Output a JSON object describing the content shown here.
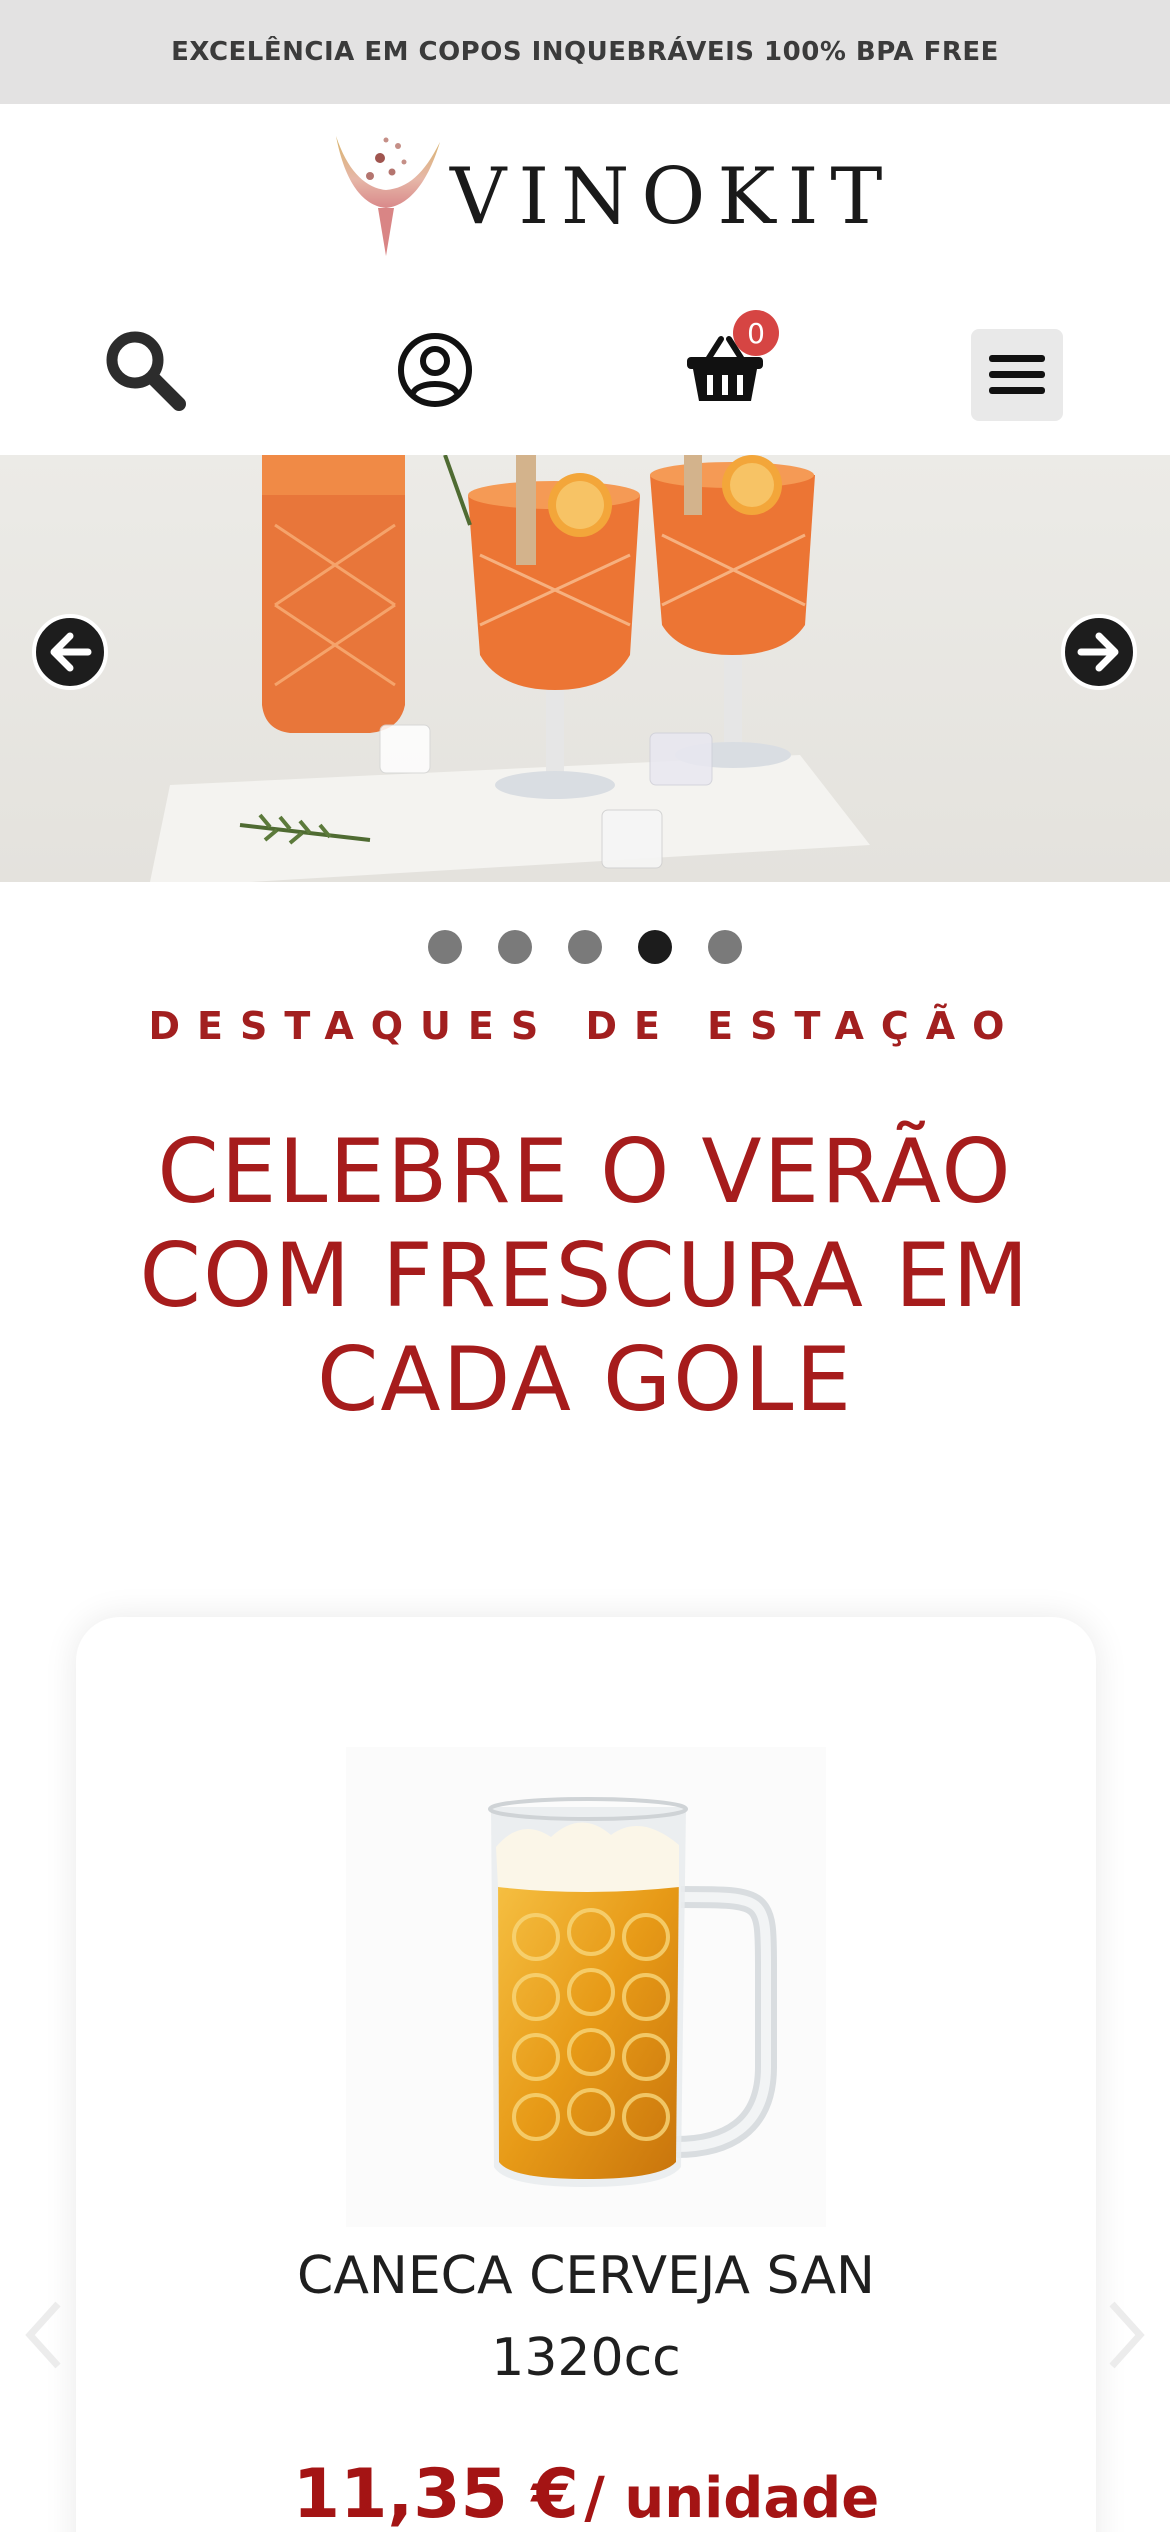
{
  "announcement": {
    "text": "EXCELÊNCIA EM COPOS INQUEBRÁVEIS 100% BPA FREE"
  },
  "brand": {
    "name": "VINOKIT",
    "accent": "#a21f1f"
  },
  "header": {
    "search_icon": "search-icon",
    "account_icon": "user-circle-icon",
    "cart_icon": "basket-icon",
    "cart_count": "0",
    "menu_icon": "hamburger-icon"
  },
  "hero": {
    "slides_total": 5,
    "active_slide": 4,
    "prev_icon": "arrow-left-icon",
    "next_icon": "arrow-right-icon"
  },
  "section": {
    "eyebrow": "DESTAQUES DE ESTAÇÃO",
    "headline_line1": "CELEBRE O VERÃO",
    "headline_line2": "COM FRESCURA EM",
    "headline_line3": "CADA GOLE"
  },
  "product": {
    "name_line1": "CANECA CERVEJA SAN",
    "name_line2": "1320cc",
    "price": "11,35 €",
    "unit": "/ unidade"
  },
  "colors": {
    "accent_red": "#a41414",
    "topbar_bg": "#e3e2e2",
    "badge": "#d64543"
  }
}
